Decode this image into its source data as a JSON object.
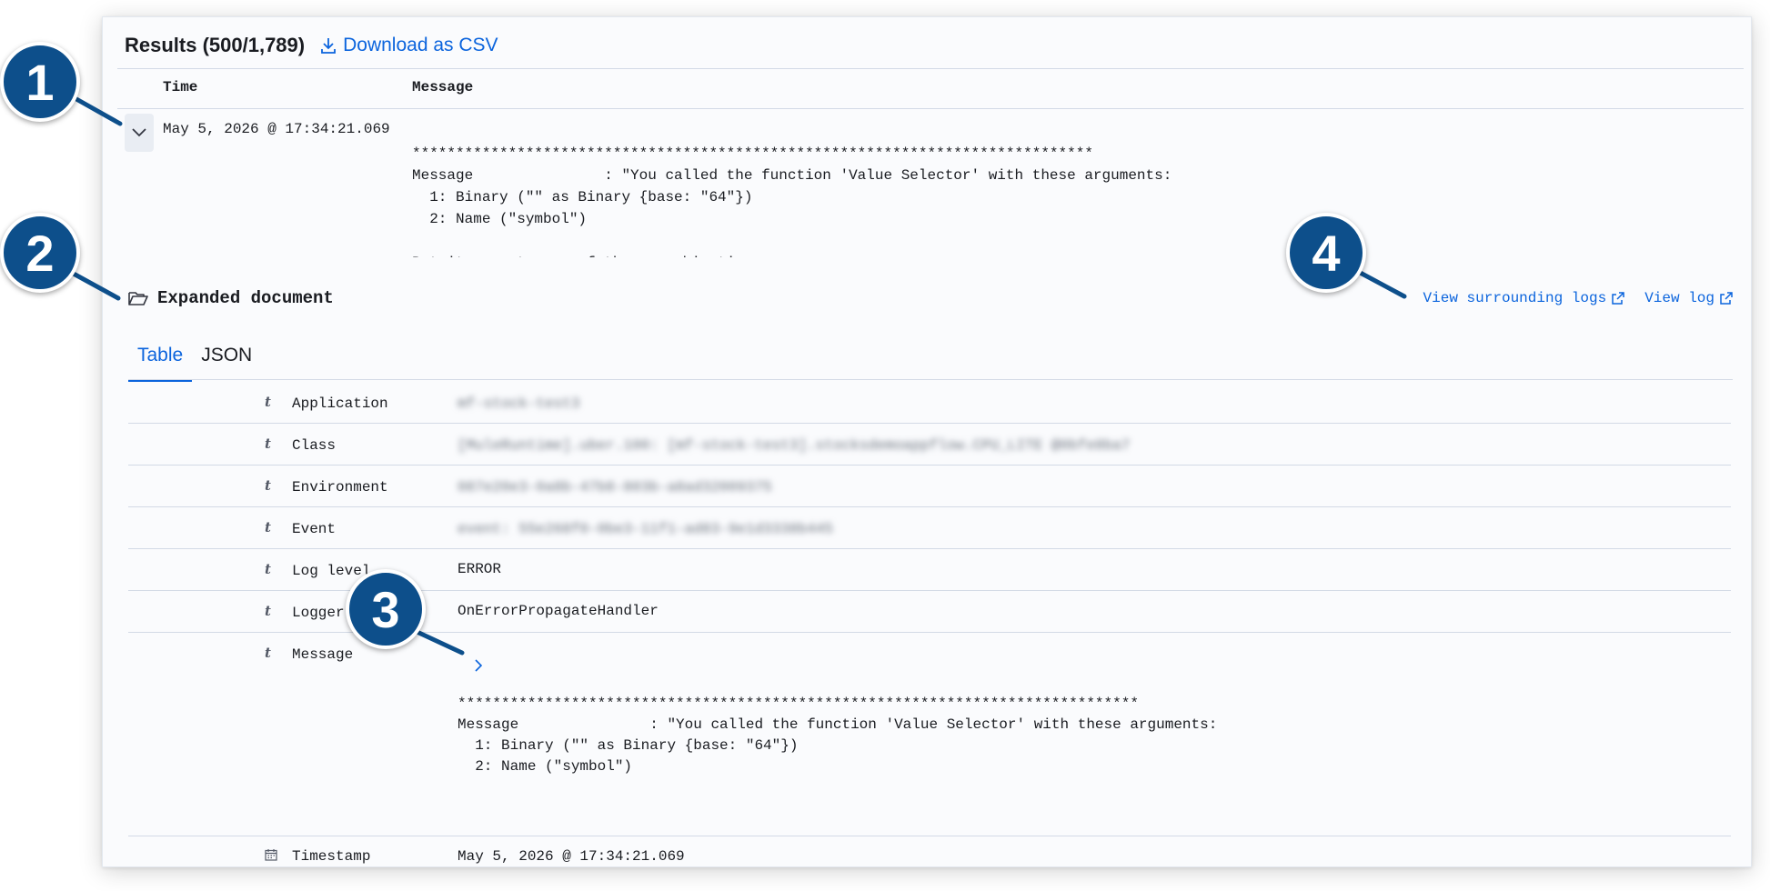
{
  "results": {
    "title": "Results (500/1,789)",
    "download_label": "Download as CSV"
  },
  "table": {
    "col_time": "Time",
    "col_message": "Message",
    "row": {
      "time": "May 5, 2026 @ 17:34:21.069",
      "message": "******************************************************************************\nMessage               : \"You called the function 'Value Selector' with these arguments:\n  1: Binary (\"\" as Binary {base: \"64\"})\n  2: Name (\"symbol\")\n\nBut it expects one of these combinations:"
    }
  },
  "expanded": {
    "title": "Expanded document",
    "view_surrounding_label": "View surrounding logs",
    "view_log_label": "View log",
    "tabs": [
      "Table",
      "JSON"
    ],
    "active_tab": "Table"
  },
  "fields": [
    {
      "type": "t",
      "name": "Application",
      "value": "mf-stock-test3",
      "blurred": true
    },
    {
      "type": "t",
      "name": "Class",
      "value": "[MuleRuntime].uber.100: [mf-stock-test3].stocksdemoappflow.CPU_LITE @0bfe8ba7",
      "blurred": true
    },
    {
      "type": "t",
      "name": "Environment",
      "value": "087e20e3-0a8b-47b8-803b-a8ad32009375",
      "blurred": true
    },
    {
      "type": "t",
      "name": "Event",
      "value": "event: 55e268f0-0be3-11f1-ad83-9e1d3338b445",
      "blurred": true
    },
    {
      "type": "t",
      "name": "Log level",
      "value": "ERROR",
      "blurred": false
    },
    {
      "type": "t",
      "name": "Logger",
      "value": "OnErrorPropagateHandler",
      "blurred": false
    },
    {
      "type": "t",
      "name": "Message",
      "value": "******************************************************************************\nMessage               : \"You called the function 'Value Selector' with these arguments:\n  1: Binary (\"\" as Binary {base: \"64\"})\n  2: Name (\"symbol\")\n\nBut it expects one of these combinations:",
      "blurred": false
    },
    {
      "type": "calendar",
      "name": "Timestamp",
      "value": "May 5, 2026 @ 17:34:21.069",
      "blurred": false
    }
  ],
  "callouts": [
    "1",
    "2",
    "3",
    "4"
  ],
  "colors": {
    "accent": "#0b64dd",
    "callout": "#0d4f8b",
    "text": "#1a1c21",
    "border": "#d3dae6"
  },
  "icons": {
    "download": "download-icon",
    "expand": "chevron-down-icon",
    "folder": "folder-open-icon",
    "external": "external-link-icon",
    "field_expand": "chevron-right-icon",
    "calendar": "calendar-icon"
  }
}
